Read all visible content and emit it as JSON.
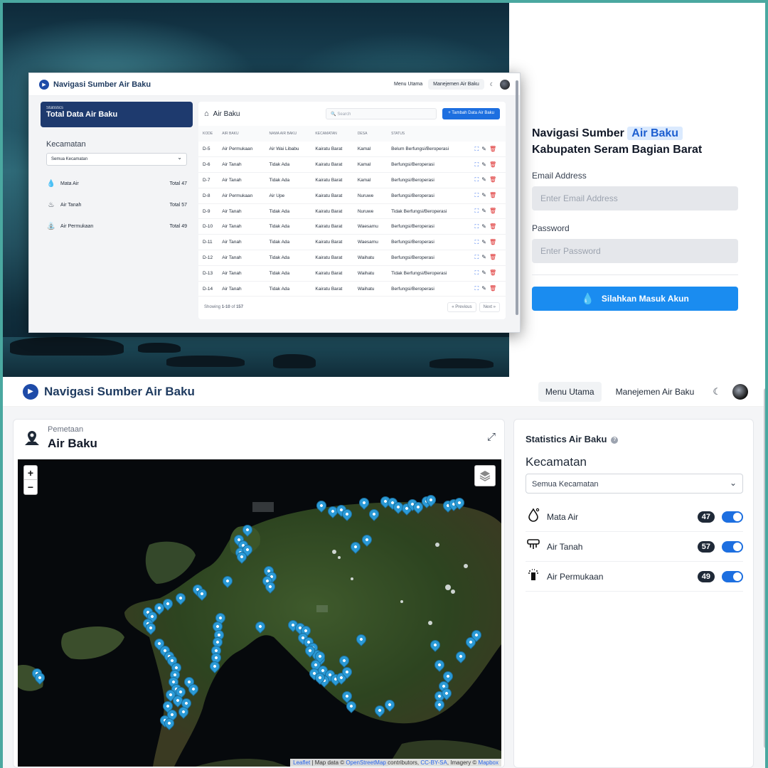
{
  "preview": {
    "brand": "Navigasi Sumber Air Baku",
    "nav": [
      "Menu Utama",
      "Manejemen Air Baku"
    ],
    "stat_label": "Statistics",
    "stat_title": "Total Data Air Baku",
    "kecamatan_label": "Kecamatan",
    "kecamatan_select": "Semua Kecamatan",
    "categories": [
      {
        "icon": "water-drop-icon",
        "label": "Mata Air",
        "total": "Total 47"
      },
      {
        "icon": "faucet-icon",
        "label": "Air Tanah",
        "total": "Total 57"
      },
      {
        "icon": "sprinkler-icon",
        "label": "Air Permukaan",
        "total": "Total 49"
      }
    ],
    "table_title": "Air Baku",
    "search_placeholder": "Search",
    "add_button": "+ Tambah Data Air Baku",
    "columns": [
      "KODE",
      "AIR BAKU",
      "NAMA AIR BAKU",
      "KECAMATAN",
      "DESA",
      "STATUS"
    ],
    "rows": [
      [
        "D-5",
        "Air Permukaan",
        "Air Wai Libabu",
        "Kairatu Barat",
        "Kamal",
        "Belum Berfungsi/Beroperasi"
      ],
      [
        "D-6",
        "Air Tanah",
        "Tidak Ada",
        "Kairatu Barat",
        "Kamal",
        "Berfungsi/Beroperasi"
      ],
      [
        "D-7",
        "Air Tanah",
        "Tidak Ada",
        "Kairatu Barat",
        "Kamal",
        "Berfungsi/Beroperasi"
      ],
      [
        "D-8",
        "Air Permukaan",
        "Air Upe",
        "Kairatu Barat",
        "Nuruwe",
        "Berfungsi/Beroperasi"
      ],
      [
        "D-9",
        "Air Tanah",
        "Tidak Ada",
        "Kairatu Barat",
        "Nuruwe",
        "Tidak Berfungsi/Beroperasi"
      ],
      [
        "D-10",
        "Air Tanah",
        "Tidak Ada",
        "Kairatu Barat",
        "Waesamu",
        "Berfungsi/Beroperasi"
      ],
      [
        "D-11",
        "Air Tanah",
        "Tidak Ada",
        "Kairatu Barat",
        "Waesamu",
        "Berfungsi/Beroperasi"
      ],
      [
        "D-12",
        "Air Tanah",
        "Tidak Ada",
        "Kairatu Barat",
        "Waihatu",
        "Berfungsi/Beroperasi"
      ],
      [
        "D-13",
        "Air Tanah",
        "Tidak Ada",
        "Kairatu Barat",
        "Waihatu",
        "Tidak Berfungsi/Beroperasi"
      ],
      [
        "D-14",
        "Air Tanah",
        "Tidak Ada",
        "Kairatu Barat",
        "Waihatu",
        "Berfungsi/Beroperasi"
      ]
    ],
    "showing_prefix": "Showing",
    "showing_range": "1-10",
    "showing_of": "of",
    "showing_total": "157",
    "prev": "« Previous",
    "next": "Next »"
  },
  "login": {
    "title_part1": "Navigasi Sumber",
    "title_highlight": "Air Baku",
    "title_part2": "Kabupaten Seram Bagian Barat",
    "email_label": "Email Address",
    "email_placeholder": "Enter Email Address",
    "password_label": "Password",
    "password_placeholder": "Enter Password",
    "submit": "Silahkan Masuk Akun"
  },
  "nav": {
    "brand": "Navigasi Sumber Air Baku",
    "menu_utama": "Menu Utama",
    "manajemen": "Manejemen Air Baku"
  },
  "map_card": {
    "subtitle": "Pemetaan",
    "title": "Air Baku",
    "zoom_in": "+",
    "zoom_out": "−",
    "attribution_leaflet": "Leaflet",
    "attribution_text1": " | Map data © ",
    "attribution_osm": "OpenStreetMap",
    "attribution_text2": " contributors, ",
    "attribution_cc": "CC-BY-SA",
    "attribution_text3": ", Imagery © ",
    "attribution_mapbox": "Mapbox"
  },
  "stats": {
    "title": "Statistics Air Baku",
    "kecamatan_label": "Kecamatan",
    "kecamatan_select": "Semua Kecamatan",
    "items": [
      {
        "icon": "water-drop-icon",
        "label": "Mata Air",
        "count": "47",
        "enabled": true
      },
      {
        "icon": "faucet-icon",
        "label": "Air Tanah",
        "count": "57",
        "enabled": true
      },
      {
        "icon": "sprinkler-icon",
        "label": "Air Permukaan",
        "count": "49",
        "enabled": true
      }
    ]
  },
  "colors": {
    "brand_navy": "#1e3a6e",
    "primary_blue": "#1d6fe0",
    "pin_blue": "#2b9ad6"
  }
}
